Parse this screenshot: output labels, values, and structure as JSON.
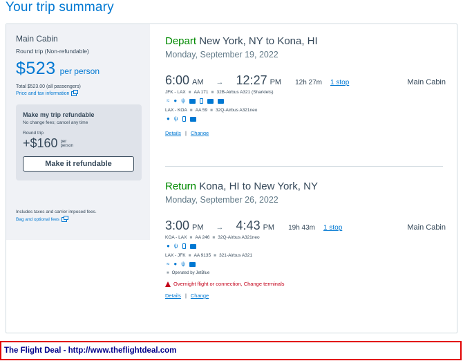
{
  "page": {
    "title": "Your trip summary"
  },
  "sidebar": {
    "cabin": "Main Cabin",
    "trip_type": "Round trip (Non-refundable)",
    "price": "$523",
    "per_person": "per person",
    "total": "Total $523.00 (all passengers)",
    "price_info_link": "Price and tax information",
    "refund": {
      "title": "Make my trip refundable",
      "subtitle": "No change fees; cancel any time",
      "trip_type": "Round trip",
      "price": "+$160",
      "per": "per",
      "person": "person",
      "button_label": "Make it refundable"
    },
    "taxes_note": "Includes taxes and carrier imposed fees.",
    "bag_link": "Bag and optional fees"
  },
  "depart": {
    "verb": "Depart",
    "route": "New York, NY to Kona, HI",
    "date": "Monday, September 19, 2022",
    "depart_time": "6:00",
    "depart_ampm": "AM",
    "arrive_time": "12:27",
    "arrive_ampm": "PM",
    "arrow": "→",
    "duration": "12h 27m",
    "stops": "1 stop",
    "cabin": "Main Cabin",
    "legs": [
      {
        "route": "JFK - LAX",
        "flight": "AA 171",
        "aircraft": "32B-Airbus A321 (Sharklets)"
      },
      {
        "route": "LAX - KOA",
        "flight": "AA 59",
        "aircraft": "32Q-Airbus A321neo"
      }
    ],
    "details": "Details",
    "change": "Change",
    "separator": "|"
  },
  "return": {
    "verb": "Return",
    "route": "Kona, HI to New York, NY",
    "date": "Monday, September 26, 2022",
    "depart_time": "3:00",
    "depart_ampm": "PM",
    "arrive_time": "4:43",
    "arrive_ampm": "PM",
    "arrow": "→",
    "duration": "19h 43m",
    "stops": "1 stop",
    "cabin": "Main Cabin",
    "legs": [
      {
        "route": "KOA - LAX",
        "flight": "AA 246",
        "aircraft": "32Q-Airbus A321neo"
      },
      {
        "route": "LAX - JFK",
        "flight": "AA 9135",
        "aircraft": "321-Airbus A321"
      }
    ],
    "operated_by": "Operated by JetBlue",
    "warning": "Overnight flight or connection, Change terminals",
    "details": "Details",
    "change": "Change",
    "separator": "|"
  },
  "footer": {
    "text": "The Flight Deal - http://www.theflightdeal.com"
  },
  "colors": {
    "accent": "#0078d2",
    "depart_green": "#008a00",
    "warning_red": "#c30019",
    "footer_border": "#e20000",
    "footer_text": "#00008b"
  }
}
